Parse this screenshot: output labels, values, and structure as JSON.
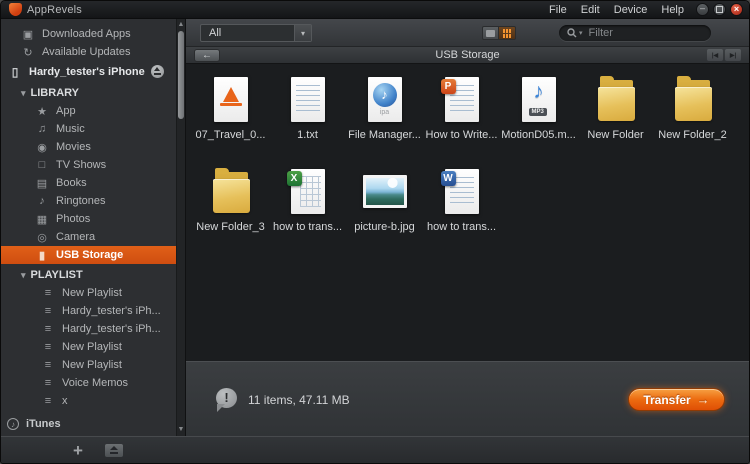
{
  "window": {
    "title": "AppRevels",
    "menus": [
      "File",
      "Edit",
      "Device",
      "Help"
    ]
  },
  "sidebar": {
    "top_items": [
      {
        "label": "Downloaded Apps",
        "icon": "apps-box-icon"
      },
      {
        "label": "Available Updates",
        "icon": "refresh-icon"
      }
    ],
    "device": {
      "label": "Hardy_tester's iPhone",
      "icon": "iphone-icon"
    },
    "sections": [
      {
        "header": "LIBRARY",
        "items": [
          {
            "label": "App",
            "icon": "app-icon"
          },
          {
            "label": "Music",
            "icon": "music-icon"
          },
          {
            "label": "Movies",
            "icon": "movies-icon"
          },
          {
            "label": "TV Shows",
            "icon": "tv-icon"
          },
          {
            "label": "Books",
            "icon": "books-icon"
          },
          {
            "label": "Ringtones",
            "icon": "ringtones-icon"
          },
          {
            "label": "Photos",
            "icon": "photos-icon"
          },
          {
            "label": "Camera",
            "icon": "camera-icon"
          },
          {
            "label": "USB Storage",
            "icon": "usb-icon",
            "selected": true
          }
        ]
      },
      {
        "header": "PLAYLIST",
        "items": [
          {
            "label": "New Playlist",
            "icon": "playlist-icon"
          },
          {
            "label": "Hardy_tester's iPh...",
            "icon": "playlist-icon"
          },
          {
            "label": "Hardy_tester's iPh...",
            "icon": "playlist-icon"
          },
          {
            "label": "New Playlist",
            "icon": "playlist-icon"
          },
          {
            "label": "New Playlist",
            "icon": "playlist-icon"
          },
          {
            "label": "Voice Memos",
            "icon": "playlist-icon"
          },
          {
            "label": "x",
            "icon": "playlist-icon"
          }
        ]
      }
    ],
    "itunes_label": "iTunes"
  },
  "toolbar": {
    "category_selected": "All",
    "filter_placeholder": "Filter"
  },
  "pathbar": {
    "title": "USB Storage"
  },
  "files": [
    {
      "name": "07_Travel_0...",
      "type": "vlc"
    },
    {
      "name": "1.txt",
      "type": "txt"
    },
    {
      "name": "File Manager...",
      "type": "ipa"
    },
    {
      "name": "How to Write...",
      "type": "ppt"
    },
    {
      "name": "MotionD05.m...",
      "type": "mp3"
    },
    {
      "name": "New Folder",
      "type": "folder"
    },
    {
      "name": "New Folder_2",
      "type": "folder"
    },
    {
      "name": "New Folder_3",
      "type": "folder"
    },
    {
      "name": "how to trans...",
      "type": "xls"
    },
    {
      "name": "picture-b.jpg",
      "type": "jpg"
    },
    {
      "name": "how to trans...",
      "type": "doc"
    }
  ],
  "icon_badges": {
    "ipa": "ipa",
    "mp3": "MP3"
  },
  "statusbar": {
    "summary": "11 items, 47.11 MB",
    "transfer_label": "Transfer"
  },
  "colors": {
    "selection_orange": "#dd5614",
    "transfer_orange_top": "#f7a143",
    "transfer_orange_bottom": "#df4f05",
    "folder_yellow": "#e6c05a",
    "main_background": "#1b1d1f",
    "sidebar_background": "#2d2f32"
  }
}
